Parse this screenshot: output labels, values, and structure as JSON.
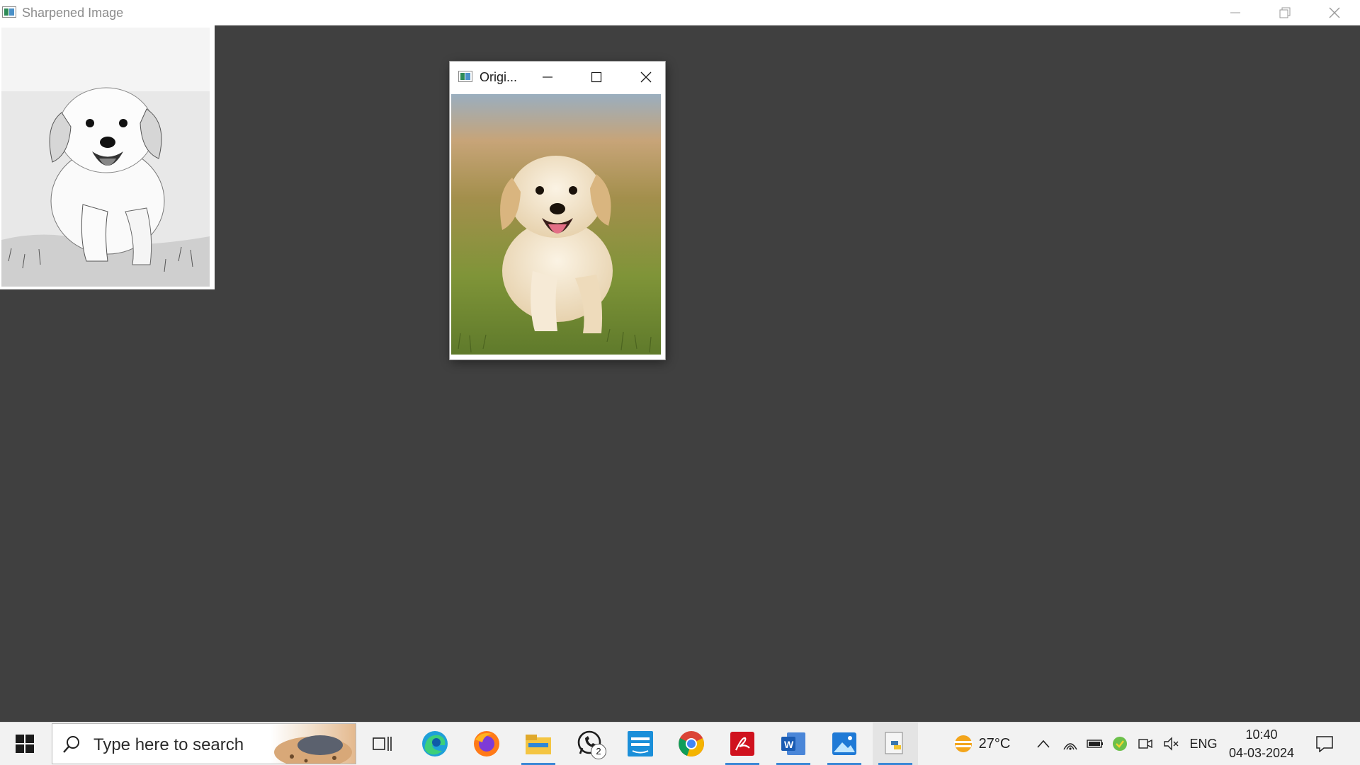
{
  "main_window": {
    "title": "Sharpened Image"
  },
  "original_window": {
    "title": "Origi..."
  },
  "taskbar": {
    "search_placeholder": "Type here to search",
    "apps": [
      {
        "name": "task-view",
        "running": false
      },
      {
        "name": "edge",
        "running": false
      },
      {
        "name": "firefox",
        "running": false
      },
      {
        "name": "file-explorer",
        "running": true
      },
      {
        "name": "whatsapp",
        "running": false,
        "badge": "2"
      },
      {
        "name": "prime-video",
        "running": false
      },
      {
        "name": "chrome",
        "running": false
      },
      {
        "name": "acrobat",
        "running": true
      },
      {
        "name": "word",
        "running": true
      },
      {
        "name": "photos",
        "running": true
      },
      {
        "name": "python",
        "running": true
      }
    ],
    "weather": {
      "temp": "27°C"
    },
    "language": "ENG",
    "time": "10:40",
    "date": "04-03-2024"
  },
  "colors": {
    "desktop": "#404040",
    "taskbar": "#f2f2f2",
    "accent": "#3a88d6"
  }
}
